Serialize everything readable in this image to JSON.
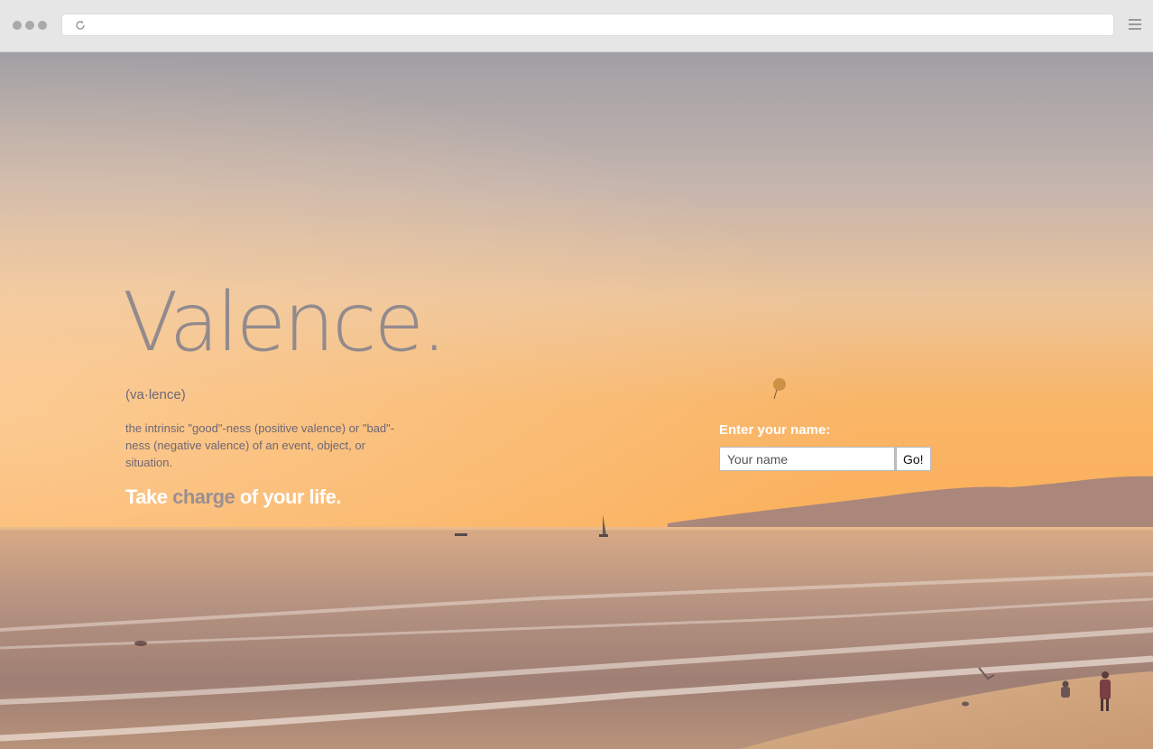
{
  "hero": {
    "title": "Valence.",
    "pronunciation": "(va·lence)",
    "definition": "the intrinsic \"good\"-ness (positive valence) or \"bad\"-ness (negative valence) of an event, object, or situation.",
    "tagline": {
      "part1": "Take ",
      "accent": "charge",
      "part2": " of your life."
    }
  },
  "form": {
    "label": "Enter your name:",
    "placeholder": "Your name",
    "value": "",
    "button": "Go!"
  },
  "colors": {
    "title": "#938a8d",
    "body_text": "#6e6776",
    "accent": "#9a8f92",
    "white": "#ffffff"
  },
  "icons": {
    "reload": "reload-icon",
    "menu": "hamburger-menu-icon"
  }
}
